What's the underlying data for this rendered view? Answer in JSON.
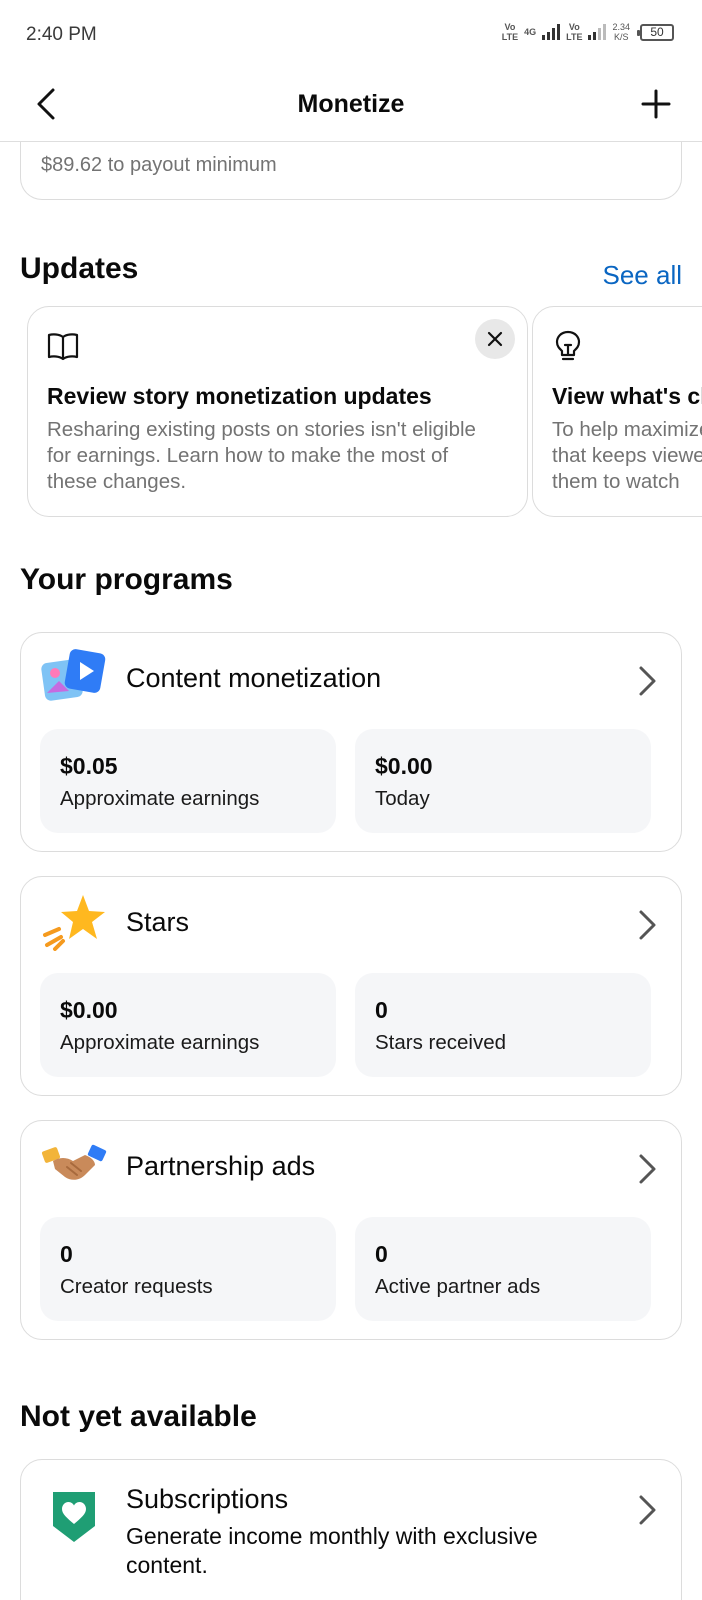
{
  "status_bar": {
    "time": "2:40 PM",
    "net1_top": "Vo",
    "net1_bottom": "LTE",
    "net2_top": "4G",
    "net3_top": "Vo",
    "net3_bottom": "LTE",
    "speed_value": "2.34",
    "speed_unit": "K/S",
    "battery": "50"
  },
  "header": {
    "title": "Monetize"
  },
  "payout": {
    "text": "$89.62 to payout minimum"
  },
  "updates": {
    "heading": "Updates",
    "see_all": "See all",
    "cards": [
      {
        "icon": "book-icon",
        "title": "Review story monetization updates",
        "body_lines": [
          "Resharing existing posts on stories isn't eligible",
          "for earnings. Learn how to make the most of",
          "these changes."
        ]
      },
      {
        "icon": "lightbulb-icon",
        "title": "View what's changed",
        "body_lines": [
          "To help maximize earnings from content",
          "that keeps viewers engaged, encourage",
          "them to watch"
        ]
      }
    ]
  },
  "programs": {
    "heading": "Your programs",
    "items": [
      {
        "title": "Content monetization",
        "icon": "content-monetization-icon",
        "stats": [
          {
            "value": "$0.05",
            "label": "Approximate earnings"
          },
          {
            "value": "$0.00",
            "label": "Today"
          }
        ]
      },
      {
        "title": "Stars",
        "icon": "star-icon",
        "stats": [
          {
            "value": "$0.00",
            "label": "Approximate earnings"
          },
          {
            "value": "0",
            "label": "Stars received"
          }
        ]
      },
      {
        "title": "Partnership ads",
        "icon": "handshake-icon",
        "stats": [
          {
            "value": "0",
            "label": "Creator requests"
          },
          {
            "value": "0",
            "label": "Active partner ads"
          }
        ]
      }
    ]
  },
  "not_available": {
    "heading": "Not yet available",
    "items": [
      {
        "title": "Subscriptions",
        "icon": "subscriptions-heart-icon",
        "desc_lines": [
          "Generate income monthly with exclusive",
          "content."
        ]
      }
    ]
  },
  "colors": {
    "link": "#0a66c2",
    "card_border": "#dcdcdc",
    "stat_bg": "#f5f6f8",
    "subscriptions_green": "#1f9e74"
  }
}
